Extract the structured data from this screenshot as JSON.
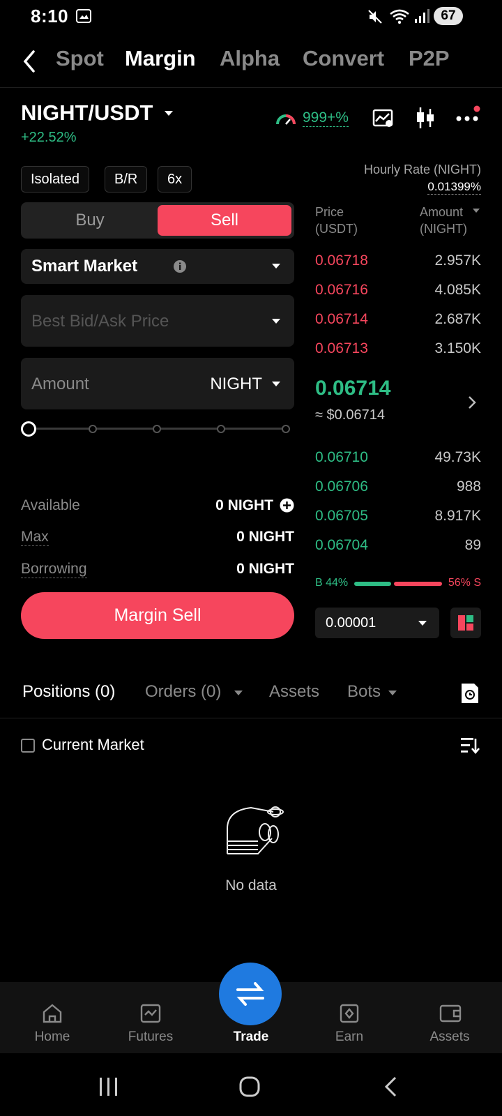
{
  "status": {
    "time": "8:10",
    "battery": "67"
  },
  "nav": {
    "tabs": [
      "Spot",
      "Margin",
      "Alpha",
      "Convert",
      "P2P"
    ],
    "active": "Margin"
  },
  "pair": {
    "symbol": "NIGHT/USDT",
    "change": "+22.52%",
    "gauge_value": "999+%"
  },
  "chips": [
    "Isolated",
    "B/R",
    "6x"
  ],
  "hourly": {
    "label": "Hourly Rate (NIGHT)",
    "value": "0.01399%"
  },
  "order": {
    "buy_label": "Buy",
    "sell_label": "Sell",
    "type": "Smart Market",
    "price_placeholder": "Best Bid/Ask Price",
    "amount_placeholder": "Amount",
    "amount_unit": "NIGHT",
    "slider_percent": 0
  },
  "balances": {
    "available_label": "Available",
    "available_value": "0 NIGHT",
    "max_label": "Max",
    "max_value": "0 NIGHT",
    "borrowing_label": "Borrowing",
    "borrowing_value": "0 NIGHT"
  },
  "submit_label": "Margin Sell",
  "orderbook": {
    "price_header": "Price",
    "price_unit": "(USDT)",
    "amount_header": "Amount",
    "amount_unit": "(NIGHT)",
    "asks": [
      {
        "price": "0.06718",
        "amount": "2.957K"
      },
      {
        "price": "0.06716",
        "amount": "4.085K"
      },
      {
        "price": "0.06714",
        "amount": "2.687K"
      },
      {
        "price": "0.06713",
        "amount": "3.150K"
      }
    ],
    "last_price": "0.06714",
    "last_price_usd": "≈ $0.06714",
    "bids": [
      {
        "price": "0.06710",
        "amount": "49.73K"
      },
      {
        "price": "0.06706",
        "amount": "988"
      },
      {
        "price": "0.06705",
        "amount": "8.917K"
      },
      {
        "price": "0.06704",
        "amount": "89"
      }
    ],
    "buy_ratio": "B 44%",
    "sell_ratio": "56% S",
    "buy_pct": 44,
    "precision": "0.00001"
  },
  "bottom_tabs": {
    "positions": "Positions (0)",
    "orders": "Orders (0)",
    "assets": "Assets",
    "bots": "Bots"
  },
  "filter_label": "Current Market",
  "empty_text": "No data",
  "bottom_nav": [
    "Home",
    "Futures",
    "Trade",
    "Earn",
    "Assets"
  ],
  "colors": {
    "green": "#2ebd85",
    "red": "#f6465d",
    "blue": "#1f7ae0"
  }
}
